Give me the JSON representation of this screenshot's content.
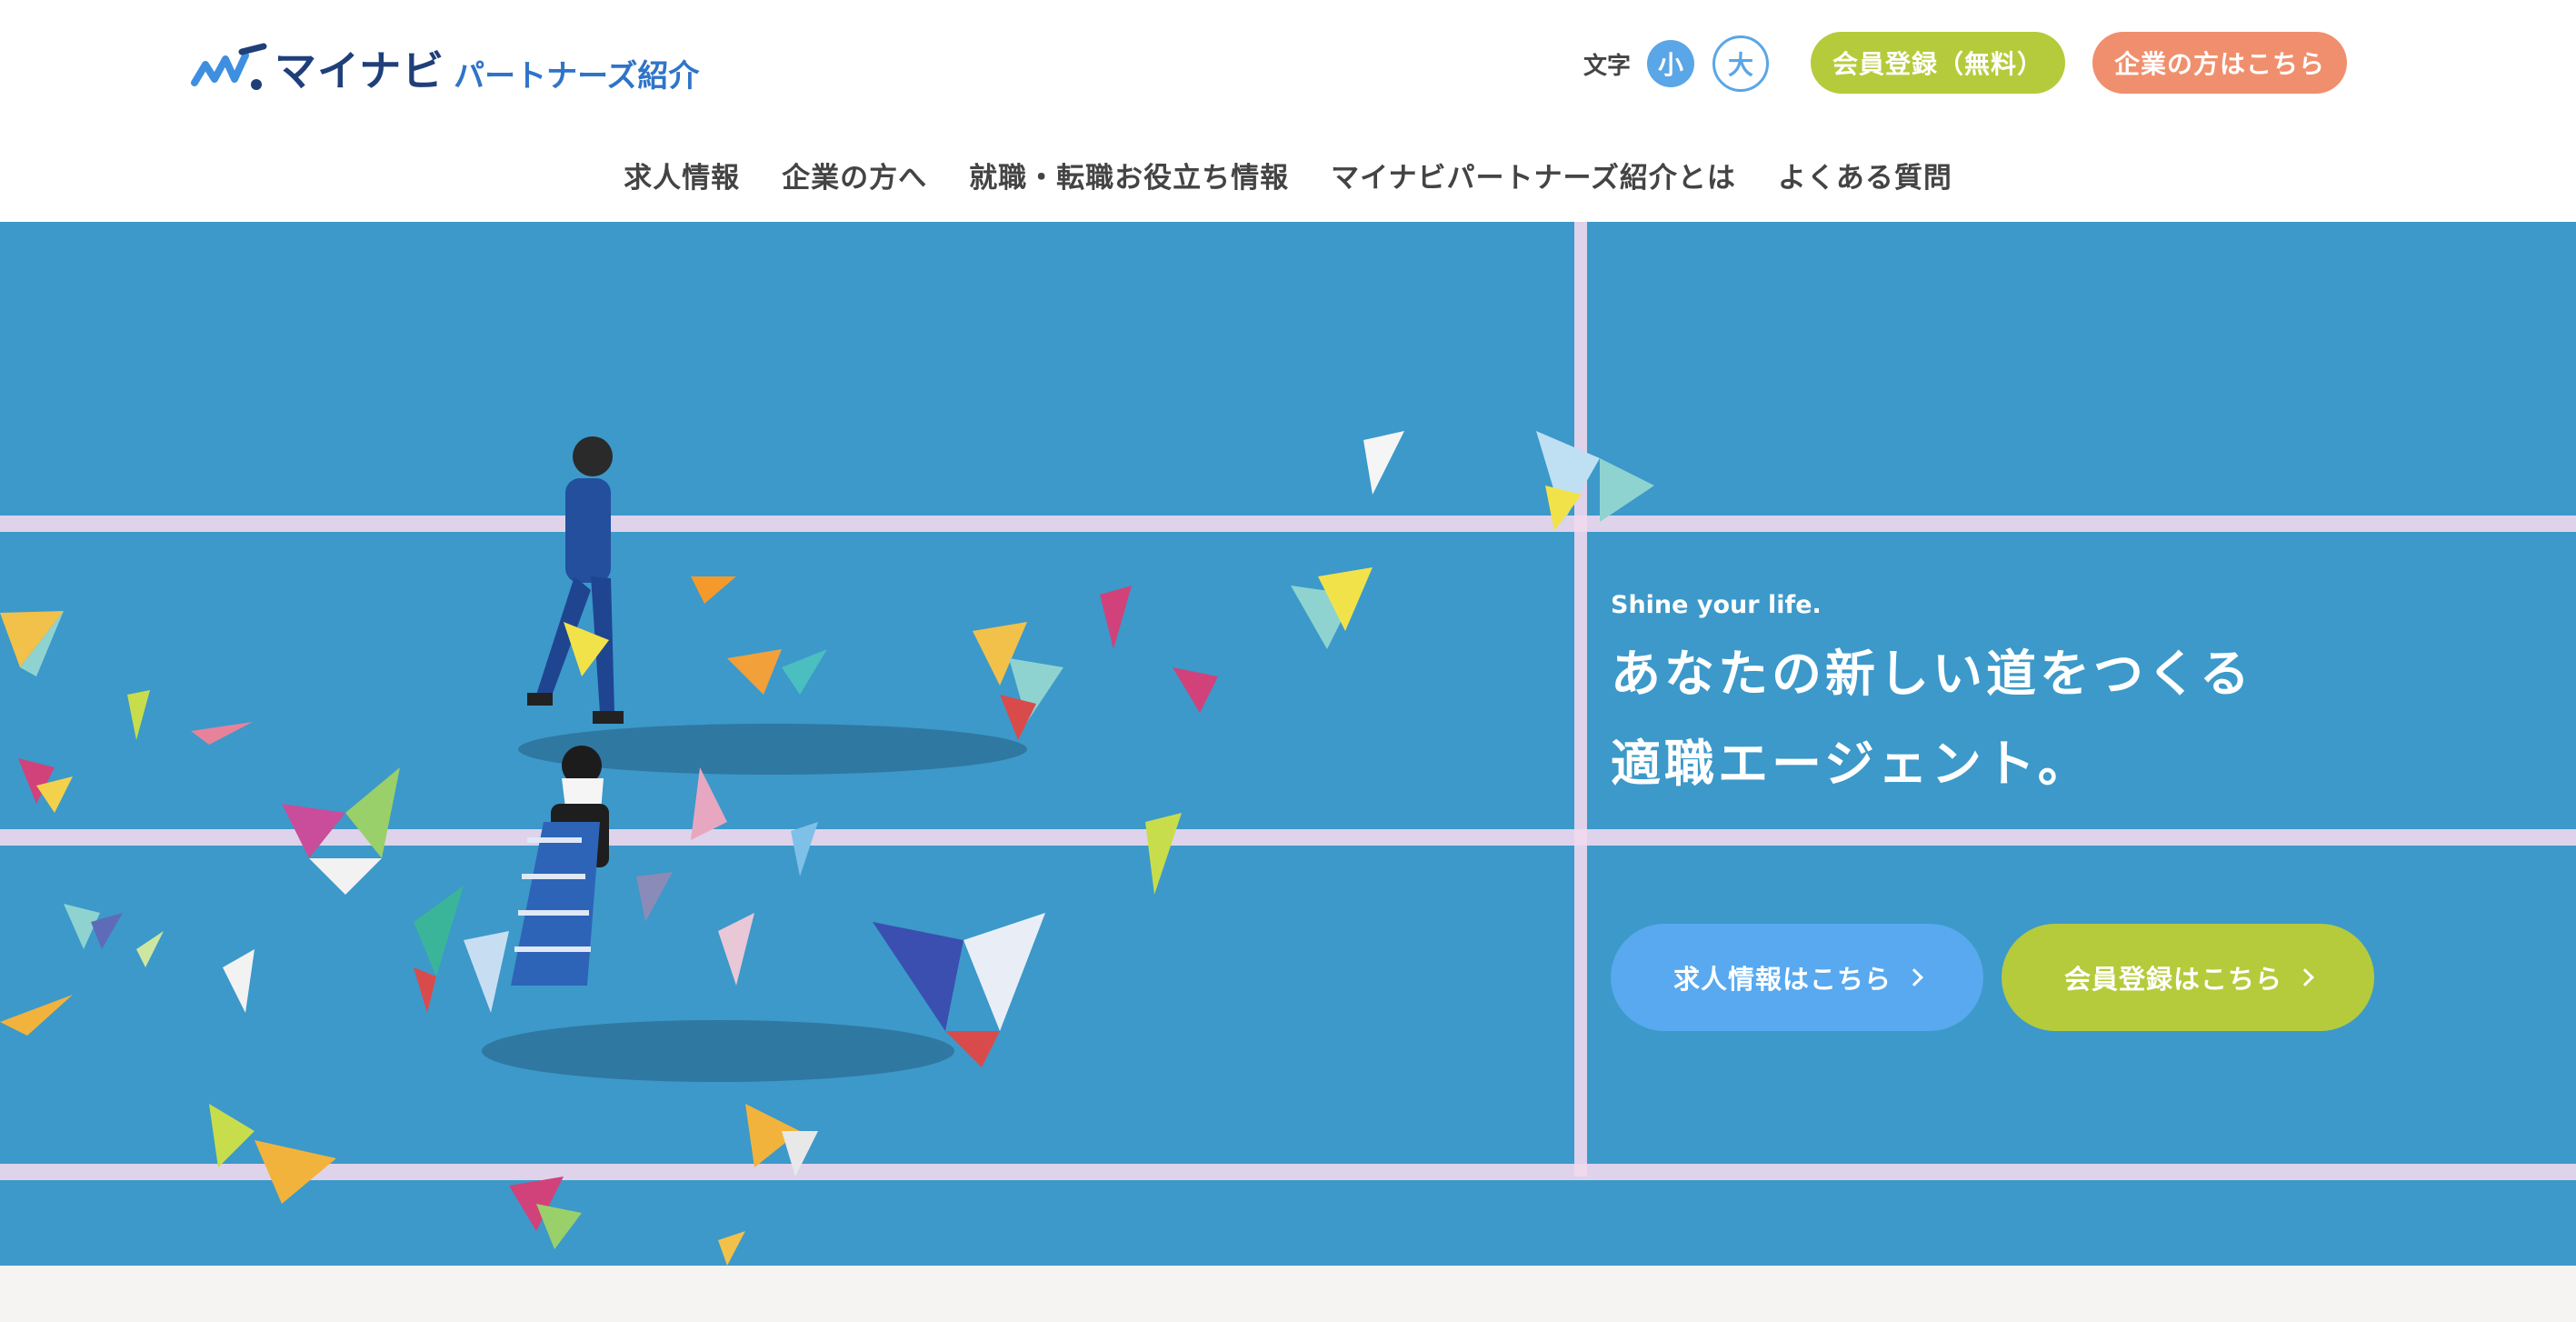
{
  "header": {
    "logo": {
      "main": "マイナビ",
      "sub": "パートナーズ紹介",
      "icon": "mynavi-swoosh-icon"
    },
    "font_size": {
      "label": "文字",
      "small": "小",
      "large": "大"
    },
    "buttons": {
      "register": "会員登録（無料）",
      "company": "企業の方はこちら"
    },
    "nav": [
      "求人情報",
      "企業の方へ",
      "就職・転職お役立ち情報",
      "マイナビパートナーズ紹介とは",
      "よくある質問"
    ]
  },
  "hero": {
    "tagline": "Shine your life.",
    "headline_line1": "あなたの新しい道をつくる",
    "headline_line2": "適職エージェント。",
    "cta_jobs": "求人情報はこちら",
    "cta_member": "会員登録はこちら",
    "illustration": "blue-court-with-walking-people-and-paper-butterflies"
  },
  "colors": {
    "hero_bg": "#3b98c9",
    "green": "#b5cb3b",
    "orange": "#f08f6d",
    "blue": "#58a9ef",
    "logo_navy": "#1f3f7a",
    "logo_blue": "#2f74c8"
  }
}
